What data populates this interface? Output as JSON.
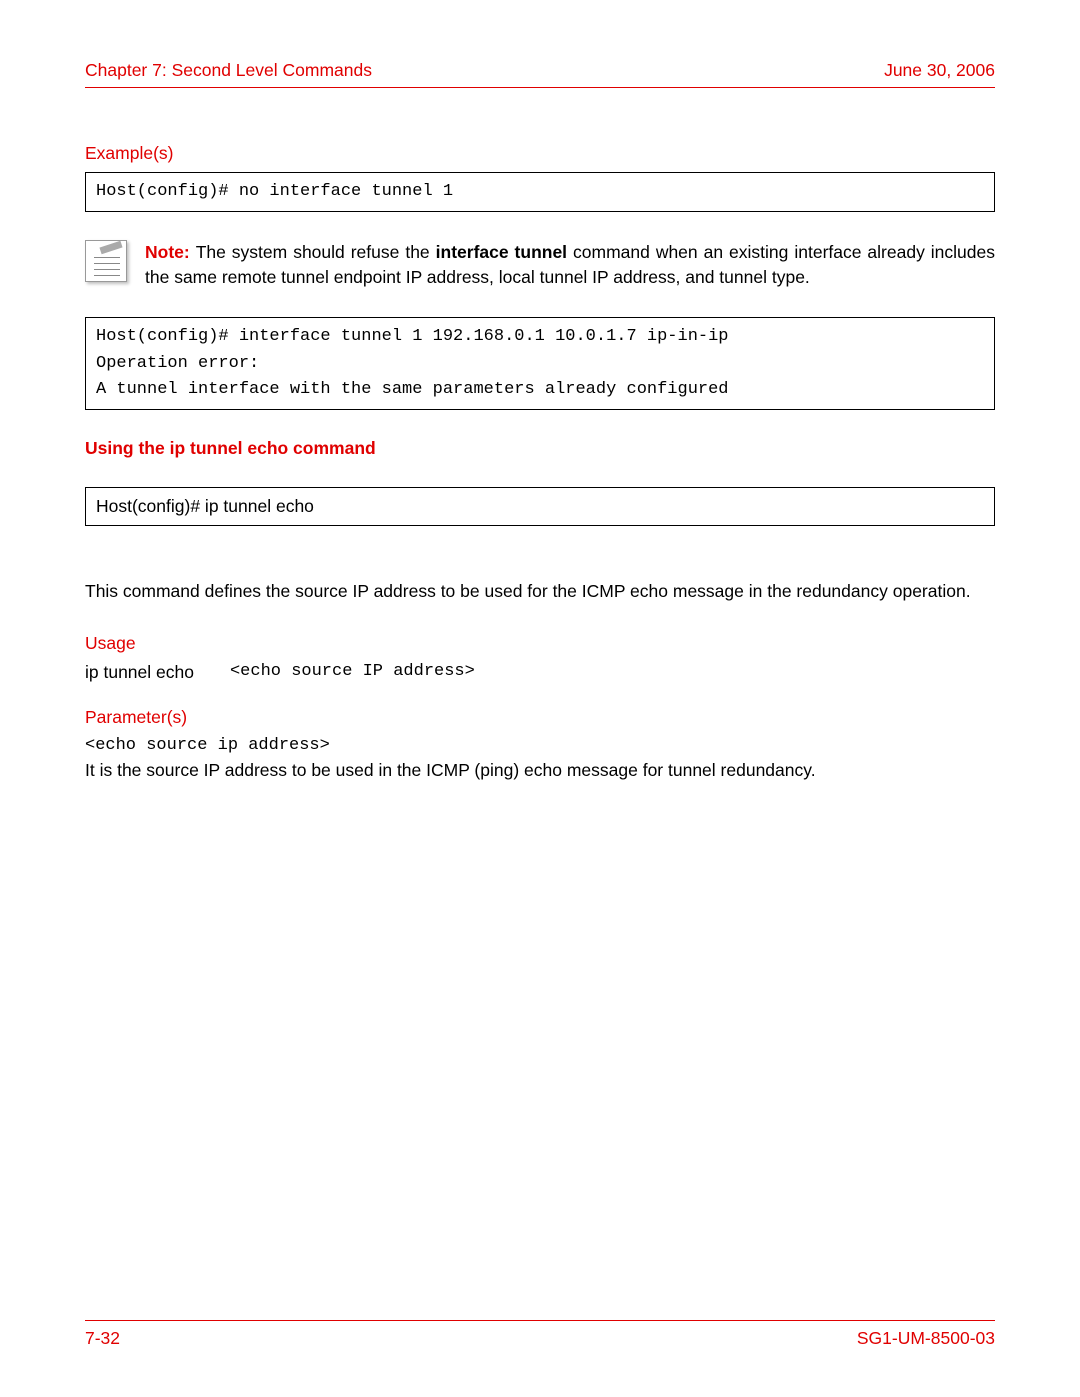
{
  "header": {
    "chapter": "Chapter 7: Second Level Commands",
    "date": "June 30, 2006"
  },
  "examples_label": "Example(s)",
  "code1": "Host(config)# no interface tunnel 1",
  "note": {
    "label": "Note: ",
    "pre_bold": "The system should refuse the ",
    "bold_cmd": "interface tunnel",
    "post_bold": " command when an existing interface already includes the same remote tunnel endpoint IP address, local tunnel IP address, and tunnel type."
  },
  "code2": "Host(config)# interface tunnel 1 192.168.0.1 10.0.1.7 ip-in-ip\nOperation error:\nA tunnel interface with the same parameters already configured",
  "section_heading": "Using the ip tunnel echo command",
  "syntax_box": "Host(config)# ip tunnel echo",
  "description": "This command defines the source IP address to be used for the ICMP echo message in the redundancy operation.",
  "usage_label": "Usage",
  "usage_cmd": "ip tunnel echo",
  "usage_arg": "<echo source IP address>",
  "parameters_label": "Parameter(s)",
  "parameter_name": "<echo source ip address>",
  "parameter_desc": "It is the source IP address to be used in the ICMP (ping) echo message for tunnel redundancy.",
  "footer": {
    "page": "7-32",
    "docid": "SG1-UM-8500-03"
  }
}
